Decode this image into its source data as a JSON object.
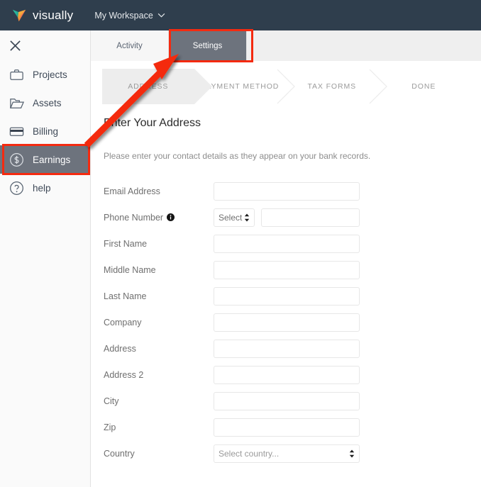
{
  "navbar": {
    "brand_name": "visually",
    "logo_icon": "visually-v-logo",
    "workspace_label": "My Workspace",
    "workspace_chevron_icon": "chevron-down-icon",
    "bg_color": "#2f3e4d"
  },
  "tabs": [
    {
      "label": "Activity",
      "active": false
    },
    {
      "label": "Settings",
      "active": true
    }
  ],
  "sidebar": {
    "close_icon": "close-icon",
    "items": [
      {
        "label": "Projects",
        "icon": "briefcase-icon",
        "selected": false
      },
      {
        "label": "Assets",
        "icon": "folder-icon",
        "selected": false
      },
      {
        "label": "Billing",
        "icon": "credit-card-icon",
        "selected": false
      },
      {
        "label": "Earnings",
        "icon": "dollar-circle-icon",
        "selected": true
      },
      {
        "label": "help",
        "icon": "question-circle-icon",
        "selected": false
      }
    ],
    "selected_bg_color": "#6d737d"
  },
  "stepper": {
    "steps": [
      {
        "label": "ADDRESS",
        "active": true
      },
      {
        "label": "PAYMENT METHOD",
        "active": false
      },
      {
        "label": "TAX FORMS",
        "active": false
      },
      {
        "label": "DONE",
        "active": false
      }
    ],
    "active_bg_color": "#ededed"
  },
  "form": {
    "title": "Enter Your Address",
    "subtitle": "Please enter your contact details as they appear on your bank records.",
    "fields": [
      {
        "label": "Email Address",
        "type": "text",
        "value": "",
        "placeholder": ""
      },
      {
        "label": "Phone Number",
        "type": "phone",
        "value": "",
        "placeholder": "",
        "info_icon": "info-icon",
        "country_code_value": "Select"
      },
      {
        "label": "First Name",
        "type": "text",
        "value": "",
        "placeholder": ""
      },
      {
        "label": "Middle Name",
        "type": "text",
        "value": "",
        "placeholder": ""
      },
      {
        "label": "Last Name",
        "type": "text",
        "value": "",
        "placeholder": ""
      },
      {
        "label": "Company",
        "type": "text",
        "value": "",
        "placeholder": ""
      },
      {
        "label": "Address",
        "type": "text",
        "value": "",
        "placeholder": ""
      },
      {
        "label": "Address 2",
        "type": "text",
        "value": "",
        "placeholder": ""
      },
      {
        "label": "City",
        "type": "text",
        "value": "",
        "placeholder": ""
      },
      {
        "label": "Zip",
        "type": "text",
        "value": "",
        "placeholder": ""
      },
      {
        "label": "Country",
        "type": "select",
        "value": "Select country..."
      }
    ]
  },
  "annotations": {
    "highlight_color": "#f42a10",
    "arrow_from": "earnings-sidebar-item",
    "arrow_to": "settings-tab"
  }
}
